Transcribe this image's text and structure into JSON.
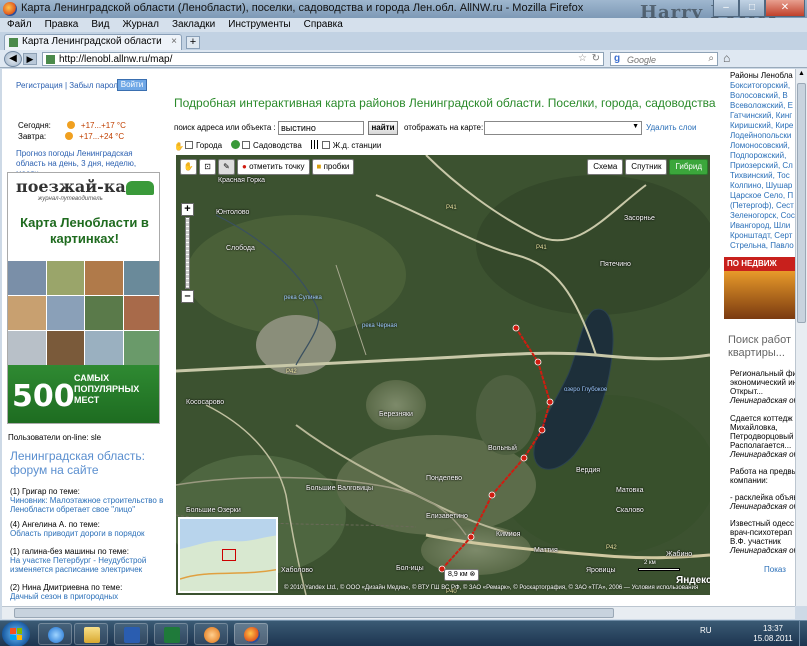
{
  "window": {
    "title": "Карта Ленинградской области (Ленобласти), поселки, садоводства и города Лен.обл. AllNW.ru - Mozilla Firefox",
    "overlay_text": "Harry Potter",
    "min": "–",
    "max": "□",
    "close": "✕"
  },
  "menu": [
    "Файл",
    "Правка",
    "Вид",
    "Журнал",
    "Закладки",
    "Инструменты",
    "Справка"
  ],
  "tab": {
    "title": "Карта Ленинградской области (Ленобл...",
    "close": "×",
    "new": "+"
  },
  "nav": {
    "url": "http://lenobl.allnw.ru/map/",
    "search_placeholder": "Google"
  },
  "left": {
    "reg_links": "Регистрация | Забыл пароль?",
    "login_button": "Войти",
    "weather": [
      {
        "day": "Сегодня:",
        "temp": "+17...+17 °C"
      },
      {
        "day": "Завтра:",
        "temp": "+17...+24 °C"
      }
    ],
    "forecast_link": "Прогноз погоды Ленинградская область на день, 3 дня, неделю, месяц",
    "banner": {
      "logo": "поезжай-ка",
      "logo_sub": "журнал-путеводитель",
      "headline": "Карта Ленобласти в картинках!",
      "number": "500",
      "number_caption": "САМЫХ ПОПУЛЯРНЫХ МЕСТ"
    },
    "online": "Пользователи on-line: sle",
    "forum_title": "Ленинградская область: форум на сайте",
    "posts": [
      {
        "who": "(1) Григар по теме:",
        "what": "Чиновник: Малоэтажное строительство в Ленобласти обретает свое \"лицо\""
      },
      {
        "who": "(4) Ангелина А. по теме:",
        "what": "Область приводит дороги в порядок"
      },
      {
        "who": "(1) галина-без машины по теме:",
        "what": "На участке Петербург - Неудубстрой изменяется расписание электричек"
      },
      {
        "who": "(2) Нина Дмитриевна по теме:",
        "what": "Дачный сезон в пригородных"
      }
    ]
  },
  "center": {
    "heading": "Подробная интерактивная карта районов Ленинградской области. Поселки, города, садоводства",
    "search_label": "поиск адреса или объекта :",
    "search_value": "выстино",
    "find_button": "найти",
    "show_label": "отображать на карте:",
    "delete_layers": "Удалить слои",
    "layers": [
      "Города",
      "Садоводства",
      "Ж.д. станции"
    ]
  },
  "map": {
    "toolbar": {
      "mark_point": "отметить точку",
      "traffic": "пробки"
    },
    "types": [
      "Схема",
      "Спутник",
      "Гибрид"
    ],
    "active_type": "Гибрид",
    "zoom_in": "+",
    "zoom_out": "–",
    "places": [
      "Красная Горка",
      "Юнтолово",
      "Слобода",
      "Кососарово",
      "Березняки",
      "Вольный",
      "Понделево",
      "Большие Валговицы",
      "Елизаветино",
      "Кимиоя",
      "Маттия",
      "Вердия",
      "Матовка",
      "Большие Озерки",
      "Скалово",
      "Пятечино",
      "Засорнье",
      "Жабино",
      "Хаболово",
      "Бол-ицы",
      "Яровицы"
    ],
    "roads": [
      "Р41",
      "Р41",
      "Р42",
      "Р42",
      "Р40"
    ],
    "waters": [
      "река Сулинка",
      "река Черная",
      "озеро Глубокое"
    ],
    "distance_label": "8,9 км",
    "scale_label": "2 км",
    "brand": "Яндекс",
    "copyright": "© 2010 Yandex Ltd., © ООО «Дизайн Медиа», © ВТУ ГШ ВС РФ, © ЗАО «Ремарк», © Роскартография, © ЗАО «ТГА», 2006 — Условия использования",
    "minimap_label": "Яндекс.Народ"
  },
  "right": {
    "list_header": "Районы Ленобла",
    "districts": [
      "Бокситогорский,",
      "Волосовский, В",
      "Всеволожский, Е",
      "Гатчинский, Кинг",
      "Киришский, Кире",
      "Лодейнопольски",
      "Ломоносовский,",
      "Подпорожский,",
      "Приозерский, Сл",
      "Тихвинский, Тос",
      "Колпино, Шушар",
      "Царское Село, П",
      "(Петергоф), Сест",
      "Зеленогорск, Сос",
      "Ивангород, Шли",
      "Кронштадт, Серт",
      "Стрельна, Павло"
    ],
    "banner_text": "ПО НЕДВИЖ",
    "search_work": "Поиск работ квартиры...",
    "news": [
      {
        "text": "Региональный фи экономический ин Открыт...",
        "src": "Ленинградская об"
      },
      {
        "text": "Сдается коттедж Михайловка, Петродворцовый Располагается...",
        "src": "Ленинградская об"
      },
      {
        "text": "Работа на предвы компании:",
        "src": ""
      },
      {
        "text": "- расклейка объяв",
        "src": "Ленинградская об"
      },
      {
        "text": "Известный одесс врач-психотерап В.Ф. участник",
        "src": "Ленинградская об"
      }
    ],
    "more": "Показ"
  },
  "taskbar": {
    "lang": "RU",
    "time": "13:37",
    "date": "15.08.2011"
  }
}
